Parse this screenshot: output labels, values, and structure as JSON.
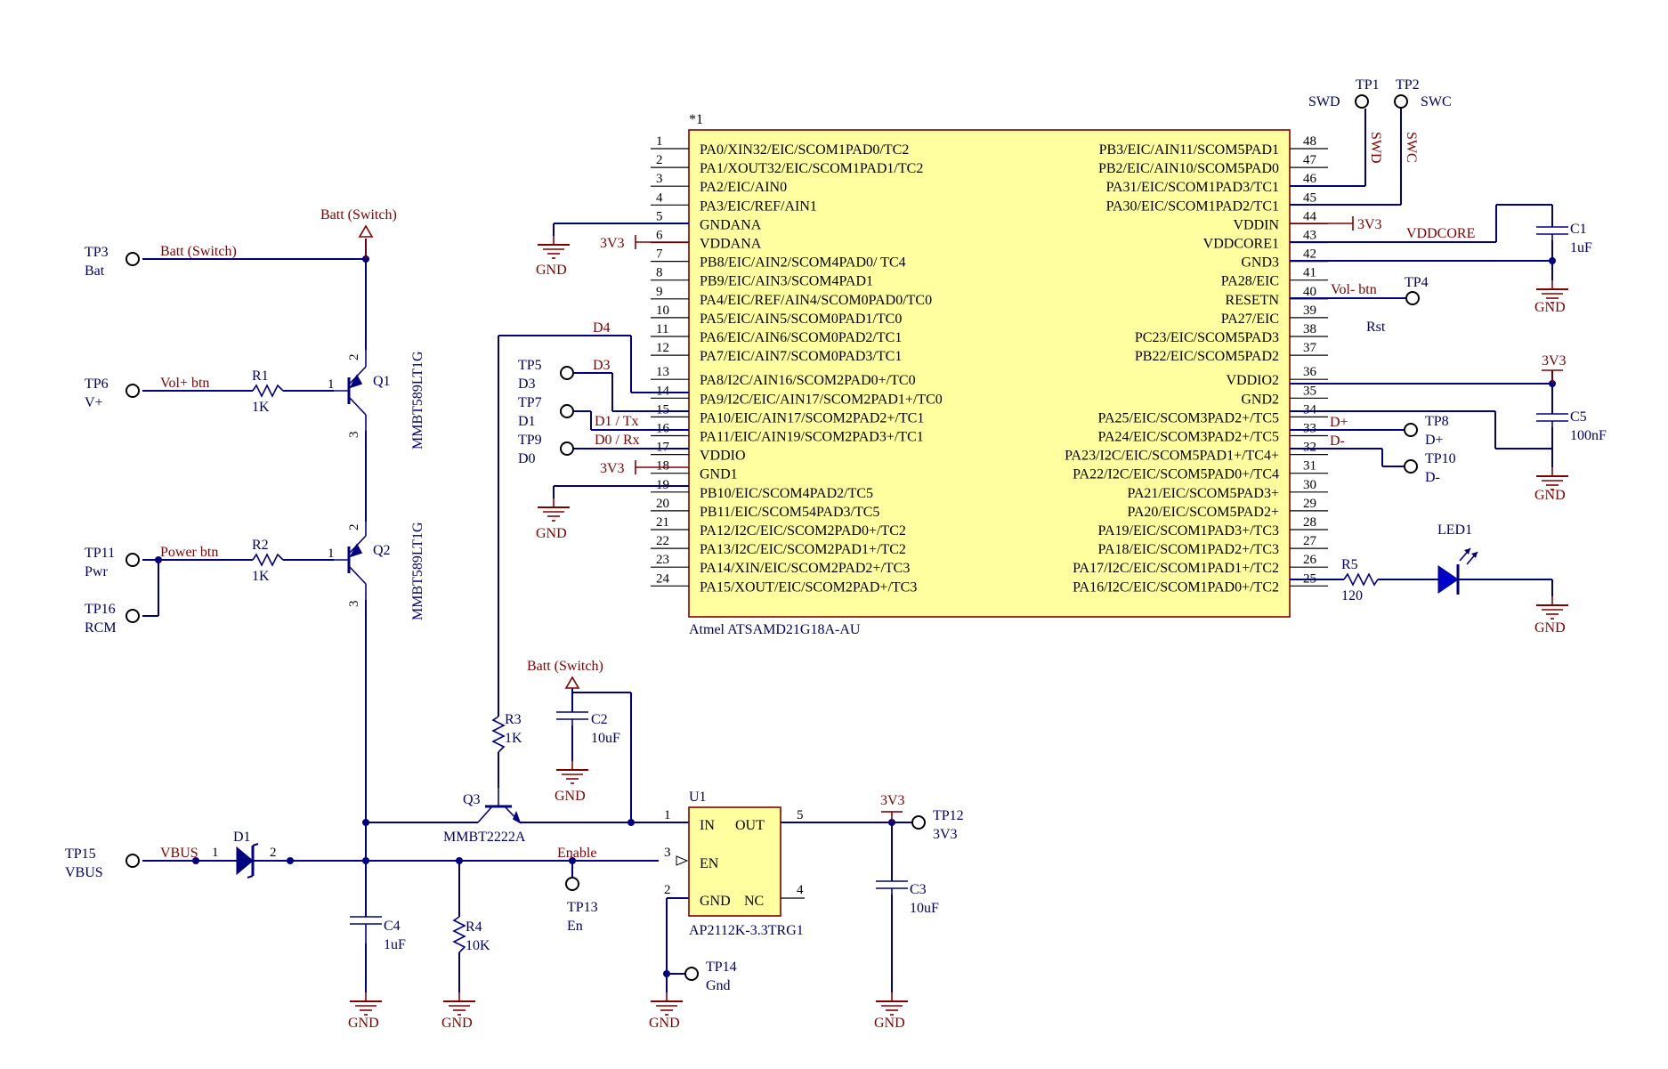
{
  "mcu": {
    "designator": "*1",
    "part": "Atmel ATSAMD21G18A-AU",
    "left_pins": [
      {
        "num": "1",
        "name": "PA0/XIN32/EIC/SCOM1PAD0/TC2"
      },
      {
        "num": "2",
        "name": "PA1/XOUT32/EIC/SCOM1PAD1/TC2"
      },
      {
        "num": "3",
        "name": "PA2/EIC/AIN0"
      },
      {
        "num": "4",
        "name": "PA3/EIC/REF/AIN1"
      },
      {
        "num": "5",
        "name": "GNDANA"
      },
      {
        "num": "6",
        "name": "VDDANA"
      },
      {
        "num": "7",
        "name": "PB8/EIC/AIN2/SCOM4PAD0/ TC4"
      },
      {
        "num": "8",
        "name": "PB9/EIC/AIN3/SCOM4PAD1"
      },
      {
        "num": "9",
        "name": "PA4/EIC/REF/AIN4/SCOM0PAD0/TC0"
      },
      {
        "num": "10",
        "name": "PA5/EIC/AIN5/SCOM0PAD1/TC0"
      },
      {
        "num": "11",
        "name": "PA6/EIC/AIN6/SCOM0PAD2/TC1"
      },
      {
        "num": "12",
        "name": "PA7/EIC/AIN7/SCOM0PAD3/TC1"
      },
      {
        "num": "13",
        "name": "PA8/I2C/AIN16/SCOM2PAD0+/TC0"
      },
      {
        "num": "14",
        "name": "PA9/I2C/EIC/AIN17/SCOM2PAD1+/TC0"
      },
      {
        "num": "15",
        "name": "PA10/EIC/AIN17/SCOM2PAD2+/TC1"
      },
      {
        "num": "16",
        "name": "PA11/EIC/AIN19/SCOM2PAD3+/TC1"
      },
      {
        "num": "17",
        "name": "VDDIO"
      },
      {
        "num": "18",
        "name": "GND1"
      },
      {
        "num": "19",
        "name": "PB10/EIC/SCOM4PAD2/TC5"
      },
      {
        "num": "20",
        "name": "PB11/EIC/SCOM54PAD3/TC5"
      },
      {
        "num": "21",
        "name": "PA12/I2C/EIC/SCOM2PAD0+/TC2"
      },
      {
        "num": "22",
        "name": "PA13/I2C/EIC/SCOM2PAD1+/TC2"
      },
      {
        "num": "23",
        "name": "PA14/XIN/EIC/SCOM2PAD2+/TC3"
      },
      {
        "num": "24",
        "name": "PA15/XOUT/EIC/SCOM2PAD+/TC3"
      }
    ],
    "right_pins": [
      {
        "num": "48",
        "name": "PB3/EIC/AIN11/SCOM5PAD1"
      },
      {
        "num": "47",
        "name": "PB2/EIC/AIN10/SCOM5PAD0"
      },
      {
        "num": "46",
        "name": "PA31/EIC/SCOM1PAD3/TC1"
      },
      {
        "num": "45",
        "name": "PA30/EIC/SCOM1PAD2/TC1"
      },
      {
        "num": "44",
        "name": "VDDIN"
      },
      {
        "num": "43",
        "name": "VDDCORE1"
      },
      {
        "num": "42",
        "name": "GND3"
      },
      {
        "num": "41",
        "name": "PA28/EIC"
      },
      {
        "num": "40",
        "name": "RESETN"
      },
      {
        "num": "39",
        "name": "PA27/EIC"
      },
      {
        "num": "38",
        "name": "PC23/EIC/SCOM5PAD3"
      },
      {
        "num": "37",
        "name": "PB22/EIC/SCOM5PAD2"
      },
      {
        "num": "36",
        "name": "VDDIO2"
      },
      {
        "num": "35",
        "name": "GND2"
      },
      {
        "num": "34",
        "name": "PA25/EIC/SCOM3PAD2+/TC5"
      },
      {
        "num": "33",
        "name": "PA24/EIC/SCOM3PAD2+/TC5"
      },
      {
        "num": "32",
        "name": "PA23/I2C/EIC/SCOM5PAD1+/TC4+"
      },
      {
        "num": "31",
        "name": "PA22/I2C/EIC/SCOM5PAD0+/TC4"
      },
      {
        "num": "30",
        "name": "PA21/EIC/SCOM5PAD3+"
      },
      {
        "num": "29",
        "name": "PA20/EIC/SCOM5PAD2+"
      },
      {
        "num": "28",
        "name": "PA19/EIC/SCOM1PAD3+/TC3"
      },
      {
        "num": "27",
        "name": "PA18/EIC/SCOM1PAD2+/TC3"
      },
      {
        "num": "26",
        "name": "PA17/I2C/EIC/SCOM1PAD1+/TC2"
      },
      {
        "num": "25",
        "name": "PA16/I2C/EIC/SCOM1PAD0+/TC2"
      }
    ]
  },
  "regulator": {
    "designator": "U1",
    "part": "AP2112K-3.3TRG1",
    "pin_in": "IN",
    "pin_out": "OUT",
    "pin_en": "EN",
    "pin_gnd": "GND",
    "pin_nc": "NC",
    "num_in": "1",
    "num_out": "5",
    "num_en": "3",
    "num_gnd": "2",
    "num_nc": "4"
  },
  "test_points": {
    "tp1": {
      "id": "TP1",
      "label": "SWD"
    },
    "tp2": {
      "id": "TP2",
      "label": "SWC"
    },
    "tp3": {
      "id": "TP3",
      "label": "Bat"
    },
    "tp4": {
      "id": "TP4",
      "label": "Rst"
    },
    "tp5": {
      "id": "TP5",
      "label": "D3"
    },
    "tp6": {
      "id": "TP6",
      "label": "V+"
    },
    "tp7": {
      "id": "TP7",
      "label": "D1"
    },
    "tp8": {
      "id": "TP8",
      "label": "D+"
    },
    "tp9": {
      "id": "TP9",
      "label": "D0"
    },
    "tp10": {
      "id": "TP10",
      "label": "D-"
    },
    "tp11": {
      "id": "TP11",
      "label": "Pwr"
    },
    "tp12": {
      "id": "TP12",
      "label": "3V3"
    },
    "tp13": {
      "id": "TP13",
      "label": "En"
    },
    "tp14": {
      "id": "TP14",
      "label": "Gnd"
    },
    "tp15": {
      "id": "TP15",
      "label": "VBUS"
    },
    "tp16": {
      "id": "TP16",
      "label": "RCM"
    }
  },
  "components": {
    "r1": {
      "id": "R1",
      "value": "1K"
    },
    "r2": {
      "id": "R2",
      "value": "1K"
    },
    "r3": {
      "id": "R3",
      "value": "1K"
    },
    "r4": {
      "id": "R4",
      "value": "10K"
    },
    "r5": {
      "id": "R5",
      "value": "120"
    },
    "c1": {
      "id": "C1",
      "value": "1uF"
    },
    "c2": {
      "id": "C2",
      "value": "10uF"
    },
    "c3": {
      "id": "C3",
      "value": "10uF"
    },
    "c4": {
      "id": "C4",
      "value": "1uF"
    },
    "c5": {
      "id": "C5",
      "value": "100nF"
    },
    "q1": {
      "id": "Q1",
      "part": "MMBT589LT1G"
    },
    "q2": {
      "id": "Q2",
      "part": "MMBT589LT1G"
    },
    "q3": {
      "id": "Q3",
      "part": "MMBT2222A"
    },
    "d1": {
      "id": "D1",
      "pin1": "1",
      "pin2": "2"
    },
    "led1": {
      "id": "LED1"
    }
  },
  "q_pins": {
    "b": "1",
    "c": "2",
    "e": "3"
  },
  "nets": {
    "swd": "SWD",
    "swc": "SWC",
    "batt_switch": "Batt (Switch)",
    "vol_plus": "Vol+ btn",
    "power_btn": "Power btn",
    "vol_minus": "Vol- btn",
    "d4": "D4",
    "d3": "D3",
    "d1_tx": "D1 / Tx",
    "d0_rx": "D0 / Rx",
    "dplus": "D+",
    "dminus": "D-",
    "vddcore": "VDDCORE",
    "vbus": "VBUS",
    "enable": "Enable"
  },
  "power": {
    "v3v3": "3V3",
    "gnd": "GND",
    "batt": "Batt (Switch)"
  },
  "colors": {
    "wire": "#000080",
    "net_label": "#800000",
    "ic_fill": "#ffffa0",
    "ic_border": "#800000"
  }
}
